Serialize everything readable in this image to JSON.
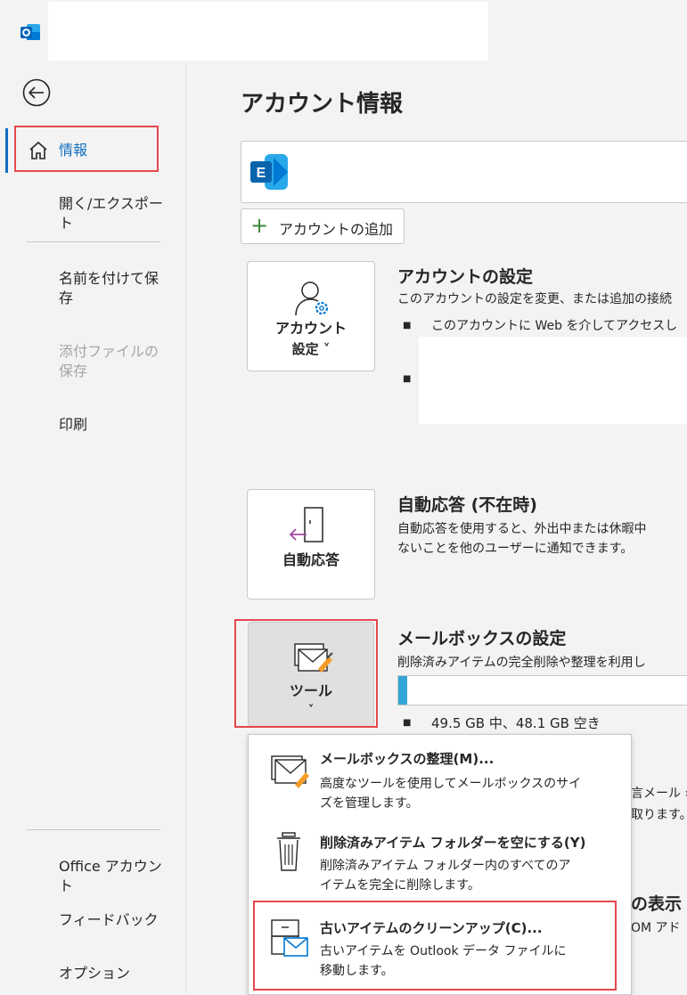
{
  "sidebar": {
    "items": [
      {
        "label": "情報",
        "active": true
      },
      {
        "label": "開く/エクスポート"
      },
      {
        "label": "名前を付けて保存"
      },
      {
        "label": "添付ファイルの保存",
        "disabled": true
      },
      {
        "label": "印刷"
      },
      {
        "label": "Office アカウント"
      },
      {
        "label": "フィードバック"
      },
      {
        "label": "オプション"
      }
    ]
  },
  "main": {
    "page_title": "アカウント情報",
    "add_account_label": "アカウントの追加",
    "account_settings": {
      "tile_label_line1": "アカウント",
      "tile_label_line2": "設定 ˅",
      "title": "アカウントの設定",
      "description": "このアカウントの設定を変更、または追加の接続",
      "bullet1": "このアカウントに Web を介してアクセスし"
    },
    "auto_reply": {
      "tile_label": "自動応答",
      "title": "自動応答 (不在時)",
      "desc_line1": "自動応答を使用すると、外出中または休暇中",
      "desc_line2": "ないことを他のユーザーに通知できます。"
    },
    "mailbox": {
      "tile_label": "ツール",
      "chevron": "˅",
      "title": "メールボックスの設定",
      "description": "削除済みアイテムの完全削除や整理を利用し",
      "usage_fraction": 0.03,
      "usage_text": "49.5 GB 中、48.1 GB 空き"
    },
    "behind_text": {
      "line1": "言メール ›",
      "line2": "取ります。",
      "heading_tail": "の表示",
      "com_tail": "OM アド"
    }
  },
  "tools_menu": {
    "items": [
      {
        "title": "メールボックスの整理(M)...",
        "desc_line1": "高度なツールを使用してメールボックスのサイ",
        "desc_line2": "ズを管理します。"
      },
      {
        "title": "削除済みアイテム フォルダーを空にする(Y)",
        "desc_line1": "削除済みアイテム フォルダー内のすべてのア",
        "desc_line2": "イテムを完全に削除します。"
      },
      {
        "title": "古いアイテムのクリーンアップ(C)...",
        "desc_line1": "古いアイテムを Outlook データ ファイルに",
        "desc_line2": "移動します。"
      }
    ]
  },
  "colors": {
    "accent": "#106ebe",
    "highlight": "#e5484d",
    "usage": "#34a5d6"
  }
}
